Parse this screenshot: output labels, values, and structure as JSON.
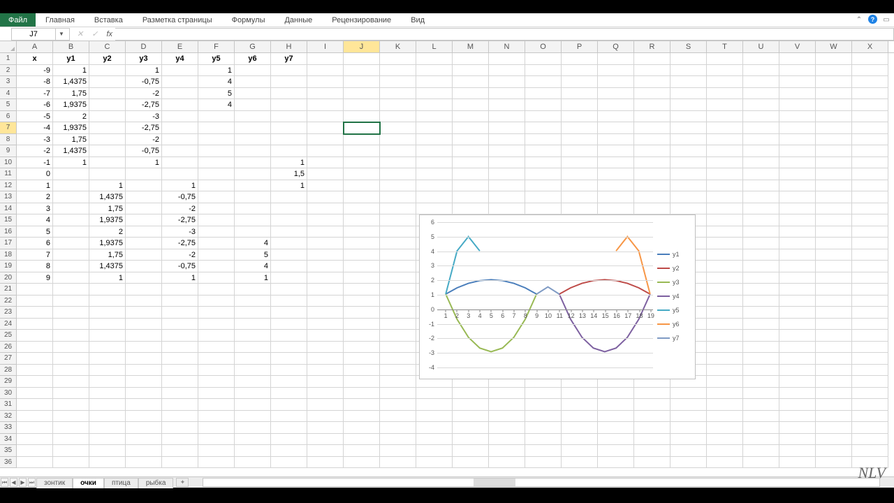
{
  "ribbon": {
    "file": "Файл",
    "tabs": [
      "Главная",
      "Вставка",
      "Разметка страницы",
      "Формулы",
      "Данные",
      "Рецензирование",
      "Вид"
    ]
  },
  "namebox": {
    "value": "J7"
  },
  "formula": {
    "value": ""
  },
  "selected": {
    "col": "J",
    "row": 7
  },
  "columns": [
    "A",
    "B",
    "C",
    "D",
    "E",
    "F",
    "G",
    "H",
    "I",
    "J",
    "K",
    "L",
    "M",
    "N",
    "O",
    "P",
    "Q",
    "R",
    "S",
    "T",
    "U",
    "V",
    "W",
    "X"
  ],
  "headerRow": [
    "x",
    "y1",
    "y2",
    "y3",
    "y4",
    "y5",
    "y6",
    "y7"
  ],
  "dataRows": [
    {
      "x": "-9",
      "y1": "1",
      "y2": "",
      "y3": "1",
      "y4": "",
      "y5": "1",
      "y6": "",
      "y7": ""
    },
    {
      "x": "-8",
      "y1": "1,4375",
      "y2": "",
      "y3": "-0,75",
      "y4": "",
      "y5": "4",
      "y6": "",
      "y7": ""
    },
    {
      "x": "-7",
      "y1": "1,75",
      "y2": "",
      "y3": "-2",
      "y4": "",
      "y5": "5",
      "y6": "",
      "y7": ""
    },
    {
      "x": "-6",
      "y1": "1,9375",
      "y2": "",
      "y3": "-2,75",
      "y4": "",
      "y5": "4",
      "y6": "",
      "y7": ""
    },
    {
      "x": "-5",
      "y1": "2",
      "y2": "",
      "y3": "-3",
      "y4": "",
      "y5": "",
      "y6": "",
      "y7": ""
    },
    {
      "x": "-4",
      "y1": "1,9375",
      "y2": "",
      "y3": "-2,75",
      "y4": "",
      "y5": "",
      "y6": "",
      "y7": ""
    },
    {
      "x": "-3",
      "y1": "1,75",
      "y2": "",
      "y3": "-2",
      "y4": "",
      "y5": "",
      "y6": "",
      "y7": ""
    },
    {
      "x": "-2",
      "y1": "1,4375",
      "y2": "",
      "y3": "-0,75",
      "y4": "",
      "y5": "",
      "y6": "",
      "y7": ""
    },
    {
      "x": "-1",
      "y1": "1",
      "y2": "",
      "y3": "1",
      "y4": "",
      "y5": "",
      "y6": "",
      "y7": "1"
    },
    {
      "x": "0",
      "y1": "",
      "y2": "",
      "y3": "",
      "y4": "",
      "y5": "",
      "y6": "",
      "y7": "1,5"
    },
    {
      "x": "1",
      "y1": "",
      "y2": "1",
      "y3": "",
      "y4": "1",
      "y5": "",
      "y6": "",
      "y7": "1"
    },
    {
      "x": "2",
      "y1": "",
      "y2": "1,4375",
      "y3": "",
      "y4": "-0,75",
      "y5": "",
      "y6": "",
      "y7": ""
    },
    {
      "x": "3",
      "y1": "",
      "y2": "1,75",
      "y3": "",
      "y4": "-2",
      "y5": "",
      "y6": "",
      "y7": ""
    },
    {
      "x": "4",
      "y1": "",
      "y2": "1,9375",
      "y3": "",
      "y4": "-2,75",
      "y5": "",
      "y6": "",
      "y7": ""
    },
    {
      "x": "5",
      "y1": "",
      "y2": "2",
      "y3": "",
      "y4": "-3",
      "y5": "",
      "y6": "",
      "y7": ""
    },
    {
      "x": "6",
      "y1": "",
      "y2": "1,9375",
      "y3": "",
      "y4": "-2,75",
      "y5": "",
      "y6": "4",
      "y7": ""
    },
    {
      "x": "7",
      "y1": "",
      "y2": "1,75",
      "y3": "",
      "y4": "-2",
      "y5": "",
      "y6": "5",
      "y7": ""
    },
    {
      "x": "8",
      "y1": "",
      "y2": "1,4375",
      "y3": "",
      "y4": "-0,75",
      "y5": "",
      "y6": "4",
      "y7": ""
    },
    {
      "x": "9",
      "y1": "",
      "y2": "1",
      "y3": "",
      "y4": "1",
      "y5": "",
      "y6": "1",
      "y7": ""
    }
  ],
  "visibleRows": 36,
  "sheets": [
    {
      "name": "зонтик",
      "active": false
    },
    {
      "name": "очки",
      "active": true
    },
    {
      "name": "птица",
      "active": false
    },
    {
      "name": "рыбка",
      "active": false
    }
  ],
  "chart_data": {
    "type": "line",
    "x": [
      1,
      2,
      3,
      4,
      5,
      6,
      7,
      8,
      9,
      10,
      11,
      12,
      13,
      14,
      15,
      16,
      17,
      18,
      19
    ],
    "ylim": [
      -4,
      6
    ],
    "series": [
      {
        "name": "y1",
        "color": "#4a7ebb",
        "values": [
          1,
          1.4375,
          1.75,
          1.9375,
          2,
          1.9375,
          1.75,
          1.4375,
          1,
          null,
          null,
          null,
          null,
          null,
          null,
          null,
          null,
          null,
          null
        ]
      },
      {
        "name": "y2",
        "color": "#be4b48",
        "values": [
          null,
          null,
          null,
          null,
          null,
          null,
          null,
          null,
          null,
          null,
          1,
          1.4375,
          1.75,
          1.9375,
          2,
          1.9375,
          1.75,
          1.4375,
          1
        ]
      },
      {
        "name": "y3",
        "color": "#98b954",
        "values": [
          1,
          -0.75,
          -2,
          -2.75,
          -3,
          -2.75,
          -2,
          -0.75,
          1,
          null,
          null,
          null,
          null,
          null,
          null,
          null,
          null,
          null,
          null
        ]
      },
      {
        "name": "y4",
        "color": "#7d60a0",
        "values": [
          null,
          null,
          null,
          null,
          null,
          null,
          null,
          null,
          null,
          null,
          1,
          -0.75,
          -2,
          -2.75,
          -3,
          -2.75,
          -2,
          -0.75,
          1
        ]
      },
      {
        "name": "y5",
        "color": "#46aac5",
        "values": [
          1,
          4,
          5,
          4,
          null,
          null,
          null,
          null,
          null,
          null,
          null,
          null,
          null,
          null,
          null,
          null,
          null,
          null,
          null
        ]
      },
      {
        "name": "y6",
        "color": "#f79646",
        "values": [
          null,
          null,
          null,
          null,
          null,
          null,
          null,
          null,
          null,
          null,
          null,
          null,
          null,
          null,
          null,
          4,
          5,
          4,
          1
        ]
      },
      {
        "name": "y7",
        "color": "#7f9bc4",
        "values": [
          null,
          null,
          null,
          null,
          null,
          null,
          null,
          null,
          1,
          1.5,
          1,
          null,
          null,
          null,
          null,
          null,
          null,
          null,
          null
        ]
      }
    ]
  },
  "watermark": "NLV"
}
